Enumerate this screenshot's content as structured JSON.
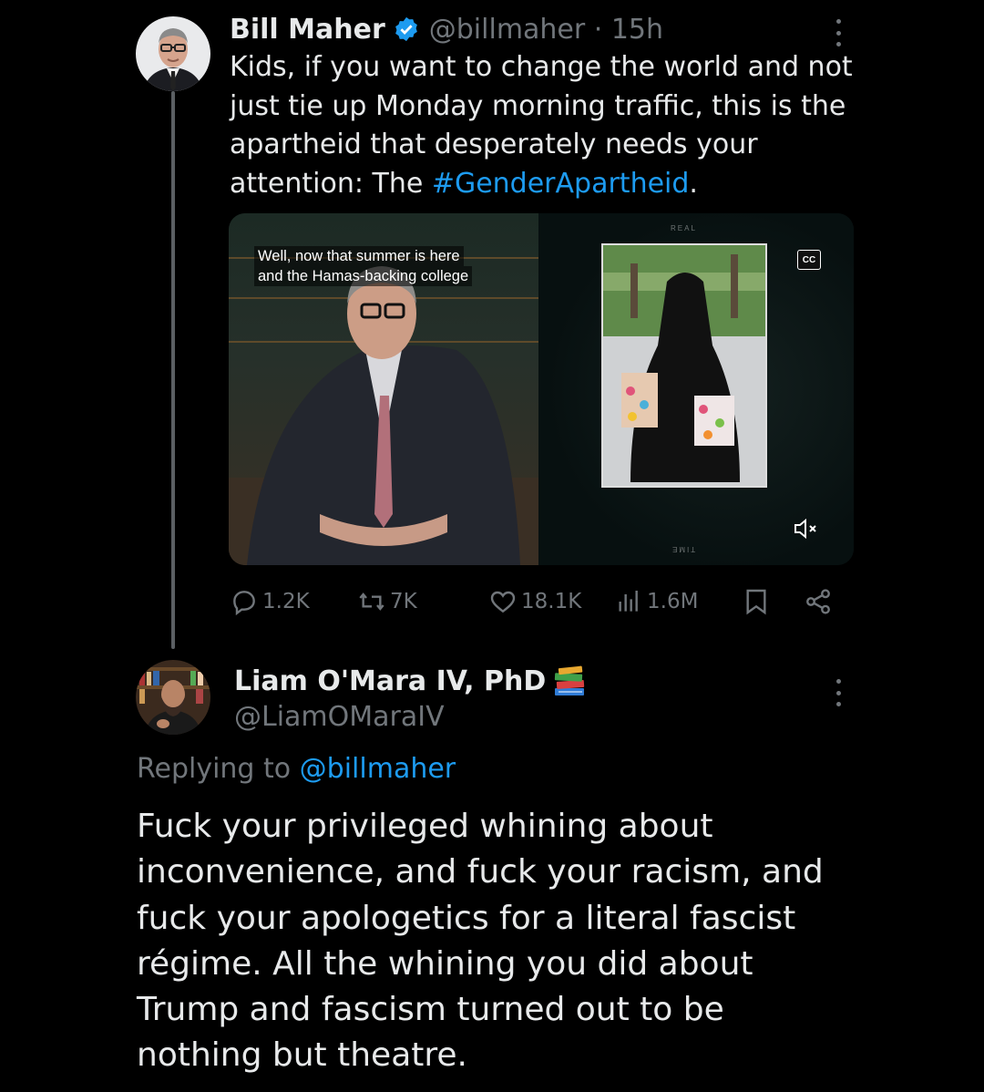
{
  "tweet": {
    "author_name": "Bill Maher",
    "author_handle": "@billmaher · 15h",
    "text_before": "Kids, if you want to change the world and not just tie up Monday morning traffic, this is the apartheid that desperately needs your attention: The ",
    "hashtag": "#GenderApartheid",
    "text_after": ".",
    "media": {
      "caption_line1": "Well, now that summer is here",
      "caption_line2": "and the Hamas-backing college",
      "cc_label": "CC",
      "top_label": "REAL",
      "bottom_label": "TIME"
    },
    "stats": {
      "replies": "1.2K",
      "reposts": "7K",
      "likes": "18.1K",
      "views": "1.6M"
    }
  },
  "reply": {
    "author_name": "Liam O'Mara IV, PhD",
    "author_handle": "@LiamOMaraIV",
    "replying_prefix": "Replying to ",
    "replying_to": "@billmaher",
    "text": "Fuck your privileged whining about inconvenience, and fuck your racism, and fuck your apologetics for a literal fascist régime. All the whining you did about Trump and fascism turned out to be nothing but theatre."
  },
  "icons": [
    "verified-badge-icon",
    "more-icon",
    "reply-icon",
    "repost-icon",
    "like-icon",
    "views-icon",
    "bookmark-icon",
    "share-icon",
    "closed-captions-icon",
    "mute-icon",
    "books-emoji-icon"
  ],
  "colors": {
    "background": "#000000",
    "text": "#e7e9ea",
    "secondary": "#71767b",
    "accent": "#1d9bf0"
  }
}
